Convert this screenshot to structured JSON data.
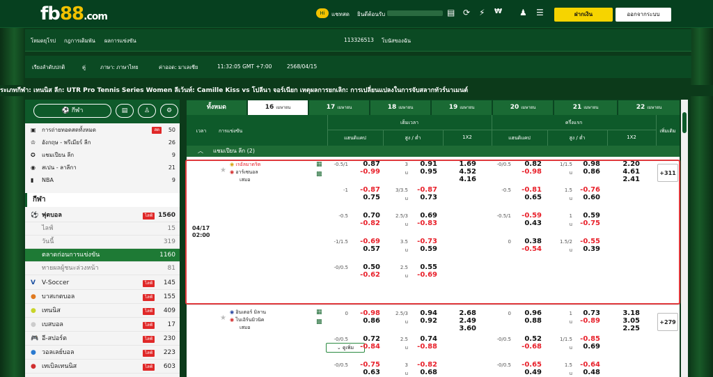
{
  "brand": {
    "logo_main": "fb",
    "logo_num": "88",
    "logo_suffix": ".com"
  },
  "topbar": {
    "chat": "แชทสด",
    "welcome": "ยินดีต้อนรับ",
    "deposit": "ฝากเงิน",
    "logout": "ออกจากระบบ"
  },
  "nav1": [
    "โหมดยุโรป",
    "กฎการเดิมพัน",
    "ผลการแข่งขัน",
    "113326513",
    "โบนัสของฉัน"
  ],
  "nav2": [
    "เรียงลำดับปกติ",
    "คู่",
    "ภาษา: ภาษาไทย",
    "ค่าออด: มาเลเซีย",
    "11:32:05 GMT +7:00",
    "2568/04/15"
  ],
  "ticker": "ระเภทกีฬา: เทนนิส ลีก: UTR Pro Tennis Series Women ลีเว้นท์: Camille Kiss vs โปลีนา จอร์เนียก เหตุผลการยกเลิก: การเปลี่ยนแปลงในการจับสลากทัวร์นาเมนต์",
  "sidebar": {
    "sport_tab": "กีฬา",
    "fav": [
      {
        "label": "การถ่ายทอดสดทั้งหมด",
        "count": "50",
        "live": "สด"
      },
      {
        "label": "อังกฤษ - พรีเมียร์ ลีก",
        "count": "26"
      },
      {
        "label": "แชมเปียน ลีก",
        "count": "9"
      },
      {
        "label": "สเปน - ลาลีกา",
        "count": "21"
      },
      {
        "label": "NBA",
        "count": "9"
      }
    ],
    "section": "กีฬา",
    "sports": [
      {
        "label": "ฟุตบอล",
        "count": "1560",
        "badge": "ไลฟ์"
      },
      {
        "label": "ไลฟ์",
        "count": "15",
        "sub": true
      },
      {
        "label": "วันนี้",
        "count": "319",
        "sub": true
      },
      {
        "label": "ตลาดก่อนการแข่งขัน",
        "count": "1160",
        "sub": true,
        "active": true
      },
      {
        "label": "ทายผลผู้ชนะล่วงหน้า",
        "count": "81",
        "sub": true
      },
      {
        "label": "V-Soccer",
        "count": "145",
        "badge": "ไลฟ์"
      },
      {
        "label": "บาสเกตบอล",
        "count": "155",
        "badge": "ไลฟ์"
      },
      {
        "label": "เทนนิส",
        "count": "409",
        "badge": "ไลฟ์"
      },
      {
        "label": "เบสบอล",
        "count": "17",
        "badge": "ไลฟ์"
      },
      {
        "label": "อี-สปอร์ต",
        "count": "230",
        "badge": "ไลฟ์"
      },
      {
        "label": "วอลเลย์บอล",
        "count": "223",
        "badge": "ไลฟ์"
      },
      {
        "label": "เทเบิลเทนนิส",
        "count": "603",
        "badge": "ไลฟ์"
      }
    ]
  },
  "date_tabs": [
    {
      "label": "ทั้งหมด"
    },
    {
      "label": "16",
      "month": "เมษายน",
      "active": true
    },
    {
      "label": "17",
      "month": "เมษายน"
    },
    {
      "label": "18",
      "month": "เมษายน"
    },
    {
      "label": "19",
      "month": "เมษายน"
    },
    {
      "label": "20",
      "month": "เมษายน"
    },
    {
      "label": "21",
      "month": "เมษายน"
    },
    {
      "label": "22",
      "month": "เมษายน"
    }
  ],
  "table_header": {
    "time": "เวลา",
    "match": "การแข่งขัน",
    "fulltime": "เต็มเวลา",
    "firsthalf": "ครึ่งแรก",
    "handicap": "แฮนดิแคป",
    "ou": "สูง / ต่ำ",
    "x12": "1X2",
    "more": "เพิ่มเติม"
  },
  "league": "แชมเปียน ลีก (2)",
  "match1": {
    "date": "04/17",
    "time": "02:00",
    "home": "เรอัลมาดริด",
    "away": "อาร์เซนอล",
    "draw": "เสมอ",
    "more": "+311",
    "see_more": "ดูเพิ่ม",
    "rows": [
      [
        "-0.5/1",
        "0.87",
        "-0.99",
        "3",
        "u",
        "0.91",
        "0.95",
        "1.69",
        "4.52",
        "4.16",
        "-0/0.5",
        "0.82",
        "-0.98",
        "1/1.5",
        "u",
        "0.98",
        "0.86",
        "2.20",
        "4.61",
        "2.41"
      ],
      [
        "-1",
        "-0.87",
        "0.75",
        "3/3.5",
        "u",
        "-0.87",
        "0.73",
        "",
        "",
        "",
        "-0.5",
        "-0.81",
        "0.65",
        "1.5",
        "u",
        "-0.76",
        "0.60",
        "",
        "",
        ""
      ],
      [
        "-0.5",
        "0.70",
        "-0.82",
        "2.5/3",
        "u",
        "0.69",
        "-0.83",
        "",
        "",
        "",
        "-0.5/1",
        "-0.59",
        "0.43",
        "1",
        "u",
        "0.59",
        "-0.75",
        "",
        "",
        ""
      ],
      [
        "-1/1.5",
        "-0.69",
        "0.57",
        "3.5",
        "u",
        "-0.73",
        "0.59",
        "",
        "",
        "",
        "0",
        "0.38",
        "-0.54",
        "1.5/2",
        "u",
        "-0.55",
        "0.39",
        "",
        "",
        ""
      ],
      [
        "-0/0.5",
        "0.50",
        "-0.62",
        "2.5",
        "u",
        "0.55",
        "-0.69",
        "",
        "",
        "",
        "",
        "",
        "",
        "",
        "",
        "",
        "",
        "",
        "",
        ""
      ]
    ]
  },
  "match2": {
    "home": "อินเตอร์ มิลาน",
    "away": "ไบเอิร์นมิวนิค",
    "draw": "เสมอ",
    "more": "+279",
    "rows": [
      [
        "0",
        "-0.98",
        "0.86",
        "2.5/3",
        "u",
        "0.94",
        "0.92",
        "2.68",
        "2.49",
        "3.60",
        "0",
        "0.96",
        "0.88",
        "1",
        "u",
        "0.73",
        "-0.89",
        "3.18",
        "3.05",
        "2.25"
      ],
      [
        "-0/0.5",
        "0.72",
        "-0.84",
        "2.5",
        "u",
        "0.74",
        "-0.88",
        "",
        "",
        "",
        "-0/0.5",
        "0.52",
        "-0.68",
        "1/1.5",
        "u",
        "-0.85",
        "0.69",
        "",
        "",
        ""
      ],
      [
        "-0/0.5",
        "-0.75",
        "0.63",
        "3",
        "u",
        "-0.82",
        "0.68",
        "",
        "",
        "",
        "-0/0.5",
        "-0.65",
        "0.49",
        "1.5",
        "u",
        "-0.64",
        "0.48",
        "",
        "",
        ""
      ]
    ]
  }
}
